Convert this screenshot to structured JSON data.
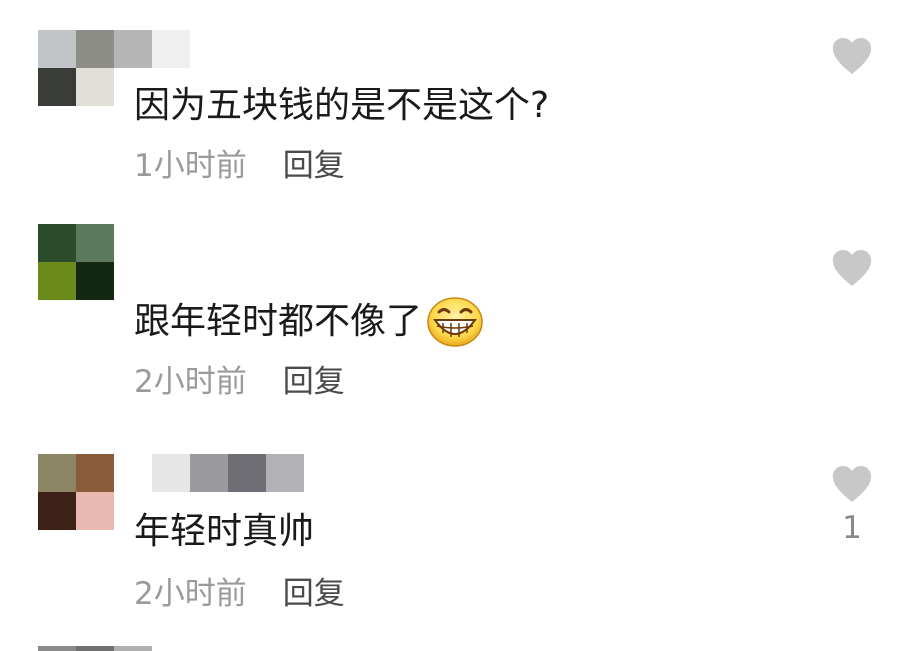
{
  "comments": [
    {
      "avatar_colors": [
        "#c3c6c9",
        "#8d8e87",
        "#3a3d37",
        "#e1dfd7"
      ],
      "username_blur_colors": [
        "#b5b5b5",
        "#f0f0f0"
      ],
      "text": "因为五块钱的是不是这个?",
      "time": "1小时前",
      "reply_label": "回复",
      "like_count": "",
      "emoji": null
    },
    {
      "avatar_colors": [
        "#2b4c2b",
        "#5b7a5b",
        "#6b8a1a",
        "#132810"
      ],
      "username_blur_colors": [],
      "text": "跟年轻时都不像了",
      "time": "2小时前",
      "reply_label": "回复",
      "like_count": "",
      "emoji": "grinning-face"
    },
    {
      "avatar_colors": [
        "#8b8566",
        "#8a5c3c",
        "#3d2016",
        "#e9b8b0"
      ],
      "username_blur_colors": [
        "#e6e6e6",
        "#9b9b9f",
        "#6e6e74",
        "#b3b3b7"
      ],
      "text": "年轻时真帅",
      "time": "2小时前",
      "reply_label": "回复",
      "like_count": "1",
      "emoji": null
    }
  ],
  "next_avatar_colors": [
    "#8a8a8a",
    "#707070",
    "#b0b0b0"
  ],
  "colors": {
    "text": "#1a1a1a",
    "meta": "#9a9a9a",
    "reply": "#4a4a4a",
    "heart": "#c8c8c8",
    "like_count": "#888888"
  }
}
